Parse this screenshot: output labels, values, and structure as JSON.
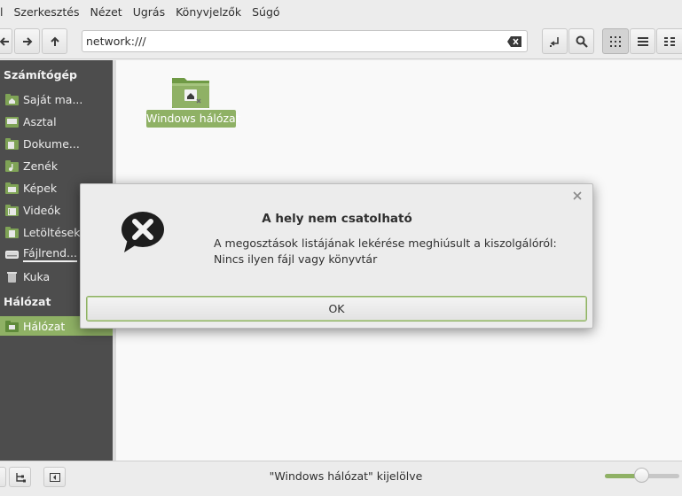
{
  "menu": [
    "l",
    "Szerkesztés",
    "Nézet",
    "Ugrás",
    "Könyvjelzők",
    "Súgó"
  ],
  "toolbar": {
    "address": "network:///",
    "back_icon": "arrow-left-icon",
    "forward_icon": "arrow-right-icon",
    "up_icon": "arrow-up-icon"
  },
  "sidebar": {
    "computer_heading": "Számítógép",
    "computer_items": [
      {
        "label": "Saját ma...",
        "icon": "home-folder-icon"
      },
      {
        "label": "Asztal",
        "icon": "desktop-folder-icon"
      },
      {
        "label": "Dokume...",
        "icon": "documents-folder-icon"
      },
      {
        "label": "Zenék",
        "icon": "music-folder-icon"
      },
      {
        "label": "Képek",
        "icon": "pictures-folder-icon"
      },
      {
        "label": "Videók",
        "icon": "videos-folder-icon"
      },
      {
        "label": "Letöltések",
        "icon": "downloads-folder-icon"
      },
      {
        "label": "Fájlrend...",
        "icon": "filesystem-icon"
      },
      {
        "label": "Kuka",
        "icon": "trash-icon"
      }
    ],
    "network_heading": "Hálózat",
    "network_items": [
      {
        "label": "Hálózat",
        "icon": "network-folder-icon",
        "selected": true
      }
    ]
  },
  "main": {
    "items": [
      {
        "label": "Windows hálózat",
        "icon": "network-share-folder-icon",
        "selected": true
      }
    ]
  },
  "statusbar": {
    "text": "\"Windows hálózat\" kijelölve",
    "zoom_level": 0.5
  },
  "dialog": {
    "title": "A hely nem csatolható",
    "message": "A megosztások listájának lekérése meghiúsult a kiszolgálóról: Nincs ilyen fájl vagy könyvtár",
    "ok_label": "OK",
    "icon": "error-speech-bubble-icon"
  },
  "colors": {
    "accent": "#8fb165",
    "sidebar_bg": "#4d4d4d",
    "window_bg": "#ececec"
  }
}
